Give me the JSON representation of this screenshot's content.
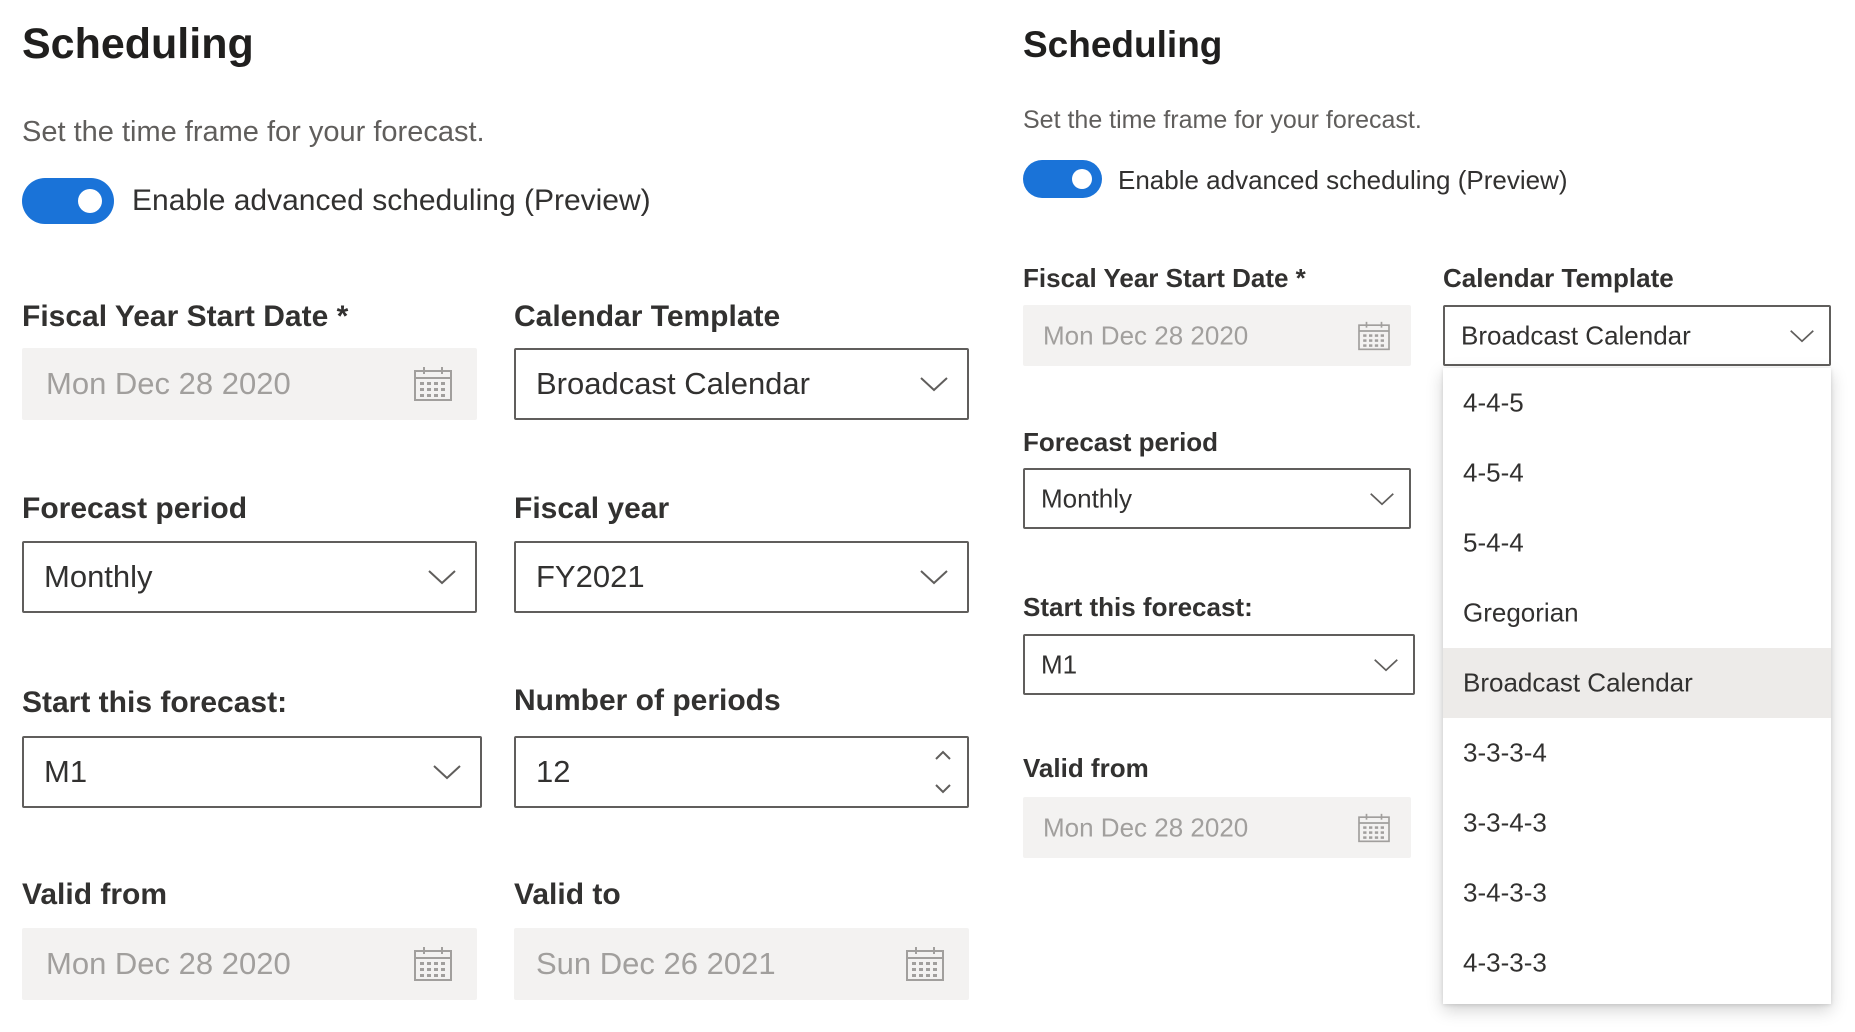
{
  "left": {
    "title": "Scheduling",
    "subtitle": "Set the time frame for your forecast.",
    "toggle_label": "Enable advanced scheduling (Preview)",
    "fiscal_start": {
      "label": "Fiscal Year Start Date *",
      "value": "Mon Dec 28 2020"
    },
    "calendar_template": {
      "label": "Calendar Template",
      "value": "Broadcast Calendar"
    },
    "forecast_period": {
      "label": "Forecast period",
      "value": "Monthly"
    },
    "fiscal_year": {
      "label": "Fiscal year",
      "value": "FY2021"
    },
    "start_forecast": {
      "label": "Start this forecast:",
      "value": "M1"
    },
    "number_of_periods": {
      "label": "Number of periods",
      "value": "12"
    },
    "valid_from": {
      "label": "Valid from",
      "value": "Mon Dec 28 2020"
    },
    "valid_to": {
      "label": "Valid to",
      "value": "Sun Dec 26 2021"
    }
  },
  "right": {
    "title": "Scheduling",
    "subtitle": "Set the time frame for your forecast.",
    "toggle_label": "Enable advanced scheduling (Preview)",
    "fiscal_start": {
      "label": "Fiscal Year Start Date *",
      "value": "Mon Dec 28 2020"
    },
    "calendar_template": {
      "label": "Calendar Template",
      "value": "Broadcast Calendar",
      "options": [
        "4-4-5",
        "4-5-4",
        "5-4-4",
        "Gregorian",
        "Broadcast Calendar",
        "3-3-3-4",
        "3-3-4-3",
        "3-4-3-3",
        "4-3-3-3"
      ],
      "selected": "Broadcast Calendar"
    },
    "forecast_period": {
      "label": "Forecast period",
      "value": "Monthly"
    },
    "start_forecast": {
      "label": "Start this forecast:",
      "value": "M1"
    },
    "valid_from": {
      "label": "Valid from",
      "value": "Mon Dec 28 2020"
    }
  },
  "colors": {
    "accent": "#1a73d8",
    "disabled_bg": "#f3f2f1",
    "selected_option_bg": "#edebe9"
  }
}
